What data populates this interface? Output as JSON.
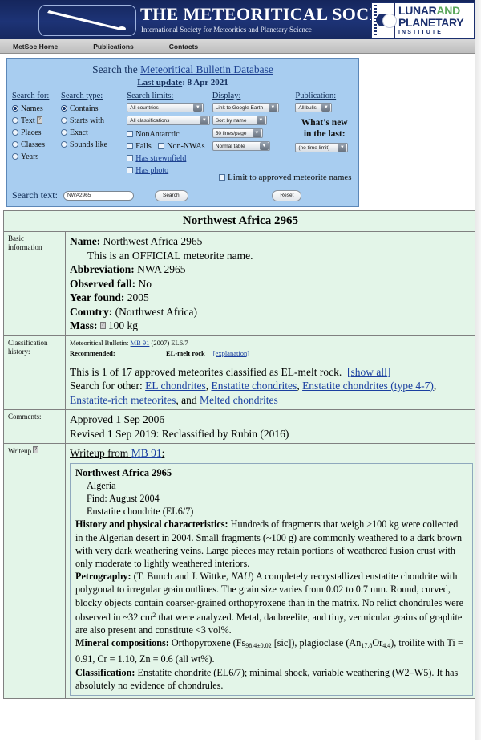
{
  "header": {
    "society_title_the": "T",
    "society_title": "HE METEORITICAL SOCIETY",
    "society_title_full": "THE METEORITICAL SOCIETY",
    "society_subtitle": "International Society for Meteoritics and Planetary Science",
    "lpi_line1_a": "LUNAR",
    "lpi_line1_b": "AND",
    "lpi_line2": "PLANETARY",
    "lpi_line3": "INSTITUTE"
  },
  "nav": {
    "items": [
      {
        "label": "MetSoc Home"
      },
      {
        "label": "Publications"
      },
      {
        "label": "Contacts"
      }
    ]
  },
  "search": {
    "title_prefix": "Search the ",
    "title_link": "Meteoritical Bulletin Database",
    "last_update_label": "Last update",
    "last_update_value": "8 Apr 2021",
    "search_for": {
      "heading": "Search for:",
      "options": [
        {
          "label": "Names",
          "selected": true
        },
        {
          "label": "Text",
          "selected": false,
          "help": "?"
        },
        {
          "label": "Places",
          "selected": false
        },
        {
          "label": "Classes",
          "selected": false
        },
        {
          "label": "Years",
          "selected": false
        }
      ]
    },
    "search_type": {
      "heading": "Search type:",
      "options": [
        {
          "label": "Contains",
          "selected": true
        },
        {
          "label": "Starts with",
          "selected": false
        },
        {
          "label": "Exact",
          "selected": false
        },
        {
          "label": "Sounds like",
          "selected": false
        }
      ]
    },
    "search_limits": {
      "heading": "Search limits:",
      "country_select": "All countries",
      "classification_select": "All classifications",
      "checkboxes": [
        {
          "label": "NonAntarctic",
          "checked": false,
          "link": false
        },
        {
          "label": "Falls",
          "checked": false,
          "link": false
        },
        {
          "label": "Non-NWAs",
          "checked": false,
          "link": false
        },
        {
          "label": "Has strewnfield",
          "checked": false,
          "link": true
        },
        {
          "label": "Has photo",
          "checked": false,
          "link": true
        }
      ],
      "search_button": "Search!"
    },
    "display": {
      "heading": "Display:",
      "map_select": "Link to Google Earth",
      "sort_select": "Sort by name",
      "lines_select": "50 lines/page",
      "table_select": "Normal table",
      "approved_checkbox": "Limit to approved meteorite names",
      "reset_button": "Reset"
    },
    "publication": {
      "heading": "Publication:",
      "bulls_select": "All bulls",
      "whats_new_line1": "What's new",
      "whats_new_line2": "in the last:",
      "time_select": "(no time limit)"
    },
    "search_text_label": "Search text:",
    "search_text_value": "NWA2965",
    "search_text_placeholder": ""
  },
  "record": {
    "title": "Northwest Africa 2965",
    "rows": {
      "basic": {
        "label_line1": "Basic",
        "label_line2": "information",
        "name_key": "Name:",
        "name_value": "Northwest Africa 2965",
        "official_note": "This is an OFFICIAL meteorite name.",
        "abbrev_key": "Abbreviation:",
        "abbrev_value": "NWA 2965",
        "fall_key": "Observed fall:",
        "fall_value": "No",
        "year_key": "Year found:",
        "year_value": "2005",
        "country_key": "Country:",
        "country_value": "(Northwest Africa)",
        "mass_key": "Mass:",
        "mass_help": "?",
        "mass_value": "100 kg"
      },
      "classification": {
        "label_line1": "Classification",
        "label_line2": "history:",
        "bulletin_label": "Meteoritical Bulletin:",
        "bulletin_link": "MB 91",
        "bulletin_year": "(2007)",
        "bulletin_class": "EL6/7",
        "recommended_label": "Recommended:",
        "recommended_value": "EL-melt rock",
        "explanation_link": "[explanation]",
        "count_text": "This is 1 of 17 approved meteorites classified as EL-melt rock.",
        "show_all_link": "[show all]",
        "search_other_label": "Search for other:",
        "other_links": [
          "EL chondrites",
          "Enstatite chondrites",
          "Enstatite chondrites (type 4-7)",
          "Enstatite-rich meteorites",
          "Melted chondrites"
        ],
        "and_word": "and"
      },
      "comments": {
        "label": "Comments:",
        "line1": "Approved 1 Sep 2006",
        "line2": "Revised 1 Sep 2019: Reclassified by Rubin (2016)"
      },
      "writeup": {
        "label": "Writeup",
        "label_help": "?",
        "heading_prefix": "Writeup from ",
        "heading_link": "MB 91",
        "heading_suffix": ":",
        "box_title": "Northwest Africa 2965",
        "country": "Algeria",
        "find": "Find: August 2004",
        "class": "Enstatite chondrite (EL6/7)",
        "history_key": "History and physical characteristics:",
        "history_text": "Hundreds of fragments that weigh >100 kg were collected in the Algerian desert in 2004. Small fragments (~100 g) are commonly weathered to a dark brown with very dark weathering veins. Large pieces may retain portions of weathered fusion crust with only moderate to lightly weathered interiors.",
        "petrography_key": "Petrography:",
        "petrography_p1": "(T. Bunch and J. Wittke, ",
        "petrography_inst": "NAU",
        "petrography_p2": ") A completely recrystallized enstatite chondrite with polygonal to irregular grain outlines. The grain size varies from 0.02 to 0.7 mm. Round, curved, blocky objects contain coarser-grained orthopyroxene than in the matrix. No relict chondrules were observed in ~32 cm",
        "petrography_sup": "2",
        "petrography_p3": " that were analyzed. Metal, daubreelite, and tiny, vermicular grains of graphite are also present and constitute <3 vol%.",
        "mineral_key": "Mineral compositions:",
        "mineral_p1": "Orthopyroxene (Fs",
        "mineral_fs_sub": "98.4±0.02",
        "mineral_p2": " [sic]), plagioclase (An",
        "mineral_an_sub": "17.8",
        "mineral_p3": "Or",
        "mineral_or_sub": "4.4",
        "mineral_p4": "), troilite with Ti = 0.91, Cr = 1.10, Zn = 0.6 (all wt%).",
        "classification_key": "Classification:",
        "classification_text": "Enstatite chondrite (EL6/7); minimal shock, variable weathering (W2–W5). It has absolutely no evidence of chondrules."
      }
    }
  },
  "colors": {
    "banner": "#1b2f6e",
    "panel_blue": "#a8cdf0",
    "table_green": "#e3f5e8",
    "link": "#1a3fa0",
    "lpi_green": "#5aa75a"
  }
}
